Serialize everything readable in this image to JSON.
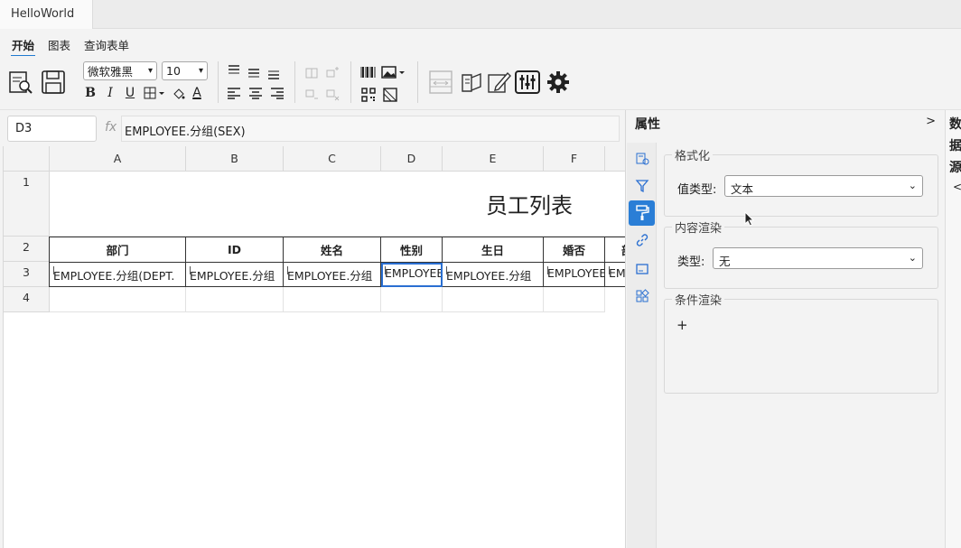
{
  "window": {
    "tab_title": "HelloWorld"
  },
  "ribbon": {
    "tabs": [
      "开始",
      "图表",
      "查询表单"
    ]
  },
  "toolbar": {
    "font_family": "微软雅黑",
    "font_size": "10",
    "bold": "B",
    "italic": "I",
    "underline": "U",
    "font_color": "A"
  },
  "formula_bar": {
    "cell_ref": "D3",
    "fx": "fx",
    "formula": "EMPLOYEE.分组(SEX)"
  },
  "grid": {
    "columns": [
      "A",
      "B",
      "C",
      "D",
      "E",
      "F"
    ],
    "rows": [
      "1",
      "2",
      "3",
      "4"
    ],
    "title": "员工列表",
    "headers": [
      "部门",
      "ID",
      "姓名",
      "性别",
      "生日",
      "婚否",
      "部"
    ],
    "data": [
      "EMPLOYEE.分组(DEPT.",
      "EMPLOYEE.分组",
      "EMPLOYEE.分组",
      "EMPLOYEE",
      "EMPLOYEE.分组",
      "EMPLOYEE",
      "EMP"
    ]
  },
  "panel": {
    "title": "属性",
    "collapse": ">",
    "format_group": {
      "legend": "格式化",
      "label": "值类型:",
      "value": "文本"
    },
    "render_group": {
      "legend": "内容渲染",
      "label": "类型:",
      "value": "无"
    },
    "cond_group": {
      "legend": "条件渲染",
      "add": "+"
    }
  },
  "datasource": {
    "title": "数据源",
    "arrow": "<"
  },
  "colors": {
    "accent": "#2a7ed6",
    "selection": "#2a6fd1"
  }
}
